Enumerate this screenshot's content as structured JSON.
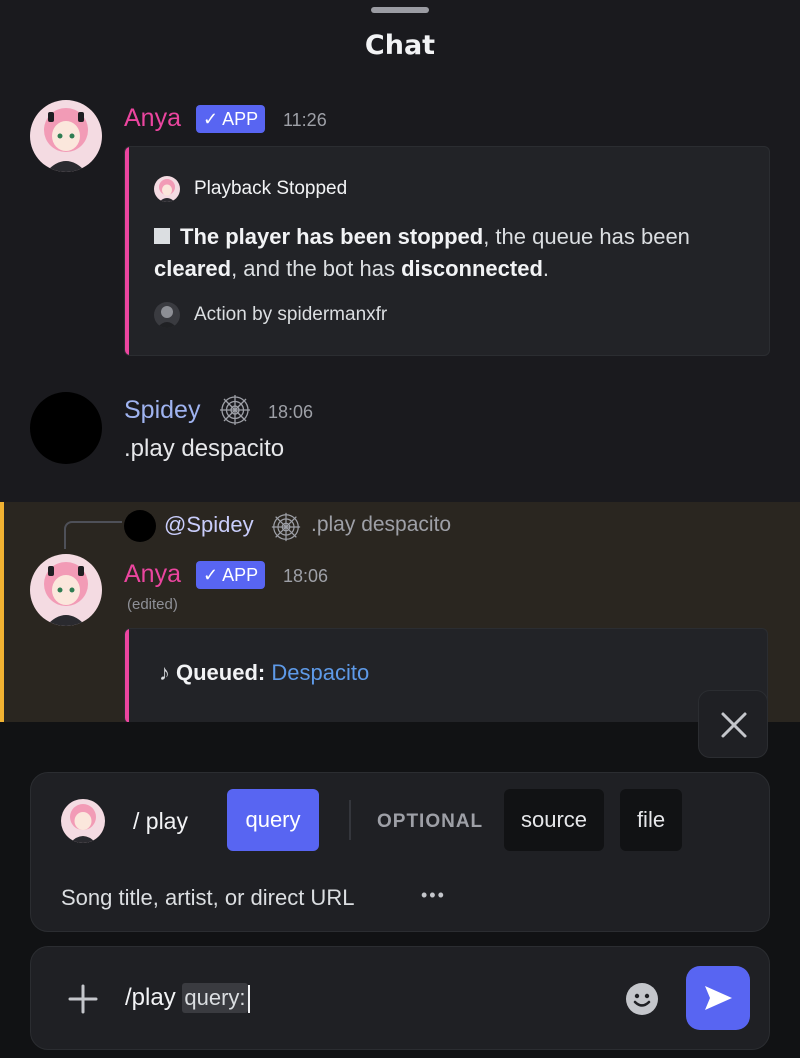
{
  "header": {
    "title": "Chat"
  },
  "messages": [
    {
      "author": "Anya",
      "badge": "✓ APP",
      "time": "11:26",
      "embed": {
        "title": "Playback Stopped",
        "desc_line1_strong": "The player has been stopped",
        "desc_line1_rest": ", the queue has been",
        "desc_line2_strong1": "cleared",
        "desc_line2_mid": ", and the bot has ",
        "desc_line2_strong2": "disconnected",
        "desc_line2_end": ".",
        "footer": "Action by spidermanxfr"
      }
    },
    {
      "author": "Spidey",
      "time": "18:06",
      "text": ".play despacito"
    },
    {
      "reply_to": "@Spidey",
      "reply_text": ".play despacito",
      "author": "Anya",
      "badge": "✓ APP",
      "time": "18:06",
      "edited": "(edited)",
      "embed": {
        "queued_label": "Queued:",
        "queued_link": "Despacito"
      }
    }
  ],
  "command_panel": {
    "command": "/ play",
    "required_option": "query",
    "optional_label": "OPTIONAL",
    "optional_options": [
      "source",
      "file"
    ],
    "description": "Song title, artist, or direct URL",
    "more": "•••"
  },
  "composer": {
    "text": "/play",
    "query_tag": "query:"
  },
  "colors": {
    "accent": "#5865f2",
    "anya": "#eb459f",
    "spidey": "#9fb3f0",
    "highlight_bar": "#f0b232",
    "link": "#5e9ae8"
  }
}
